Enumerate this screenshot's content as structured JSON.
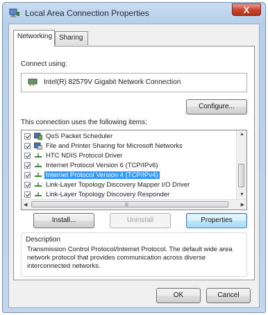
{
  "window": {
    "title": "Local Area Connection Properties",
    "close_label": "X"
  },
  "tabs": [
    {
      "label": "Networking",
      "active": true
    },
    {
      "label": "Sharing",
      "active": false
    }
  ],
  "connect_using": {
    "label": "Connect using:",
    "adapter": "Intel(R) 82579V Gigabit Network Connection",
    "configure_button": "Configure..."
  },
  "items_section": {
    "label": "This connection uses the following items:",
    "items": [
      {
        "label": "QoS Packet Scheduler",
        "checked": true,
        "icon": "qos-icon",
        "selected": false
      },
      {
        "label": "File and Printer Sharing for Microsoft Networks",
        "checked": true,
        "icon": "file-printer-sharing-icon",
        "selected": false
      },
      {
        "label": "HTC NDIS Protocol Driver",
        "checked": true,
        "icon": "protocol-icon",
        "selected": false
      },
      {
        "label": "Internet Protocol Version 6 (TCP/IPv6)",
        "checked": true,
        "icon": "protocol-icon",
        "selected": false
      },
      {
        "label": "Internet Protocol Version 4 (TCP/IPv4)",
        "checked": true,
        "icon": "protocol-icon",
        "selected": true
      },
      {
        "label": "Link-Layer Topology Discovery Mapper I/O Driver",
        "checked": true,
        "icon": "protocol-icon",
        "selected": false
      },
      {
        "label": "Link-Layer Topology Discovery Responder",
        "checked": true,
        "icon": "protocol-icon",
        "selected": false
      }
    ]
  },
  "actions": {
    "install": "Install...",
    "uninstall": "Uninstall",
    "properties": "Properties"
  },
  "description": {
    "label": "Description",
    "text": "Transmission Control Protocol/Internet Protocol. The default wide area network protocol that provides communication across diverse interconnected networks."
  },
  "dialog_buttons": {
    "ok": "OK",
    "cancel": "Cancel"
  },
  "colors": {
    "selection": "#3399ff",
    "close": "#c9452f"
  }
}
